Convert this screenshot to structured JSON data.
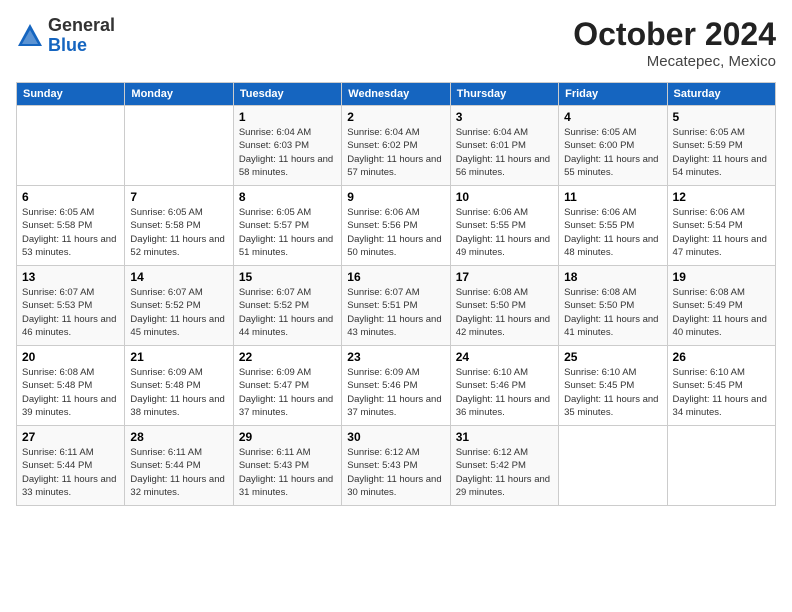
{
  "header": {
    "logo_line1": "General",
    "logo_line2": "Blue",
    "month_year": "October 2024",
    "location": "Mecatepec, Mexico"
  },
  "weekdays": [
    "Sunday",
    "Monday",
    "Tuesday",
    "Wednesday",
    "Thursday",
    "Friday",
    "Saturday"
  ],
  "weeks": [
    [
      {
        "day": "",
        "detail": ""
      },
      {
        "day": "",
        "detail": ""
      },
      {
        "day": "1",
        "detail": "Sunrise: 6:04 AM\nSunset: 6:03 PM\nDaylight: 11 hours and 58 minutes."
      },
      {
        "day": "2",
        "detail": "Sunrise: 6:04 AM\nSunset: 6:02 PM\nDaylight: 11 hours and 57 minutes."
      },
      {
        "day": "3",
        "detail": "Sunrise: 6:04 AM\nSunset: 6:01 PM\nDaylight: 11 hours and 56 minutes."
      },
      {
        "day": "4",
        "detail": "Sunrise: 6:05 AM\nSunset: 6:00 PM\nDaylight: 11 hours and 55 minutes."
      },
      {
        "day": "5",
        "detail": "Sunrise: 6:05 AM\nSunset: 5:59 PM\nDaylight: 11 hours and 54 minutes."
      }
    ],
    [
      {
        "day": "6",
        "detail": "Sunrise: 6:05 AM\nSunset: 5:58 PM\nDaylight: 11 hours and 53 minutes."
      },
      {
        "day": "7",
        "detail": "Sunrise: 6:05 AM\nSunset: 5:58 PM\nDaylight: 11 hours and 52 minutes."
      },
      {
        "day": "8",
        "detail": "Sunrise: 6:05 AM\nSunset: 5:57 PM\nDaylight: 11 hours and 51 minutes."
      },
      {
        "day": "9",
        "detail": "Sunrise: 6:06 AM\nSunset: 5:56 PM\nDaylight: 11 hours and 50 minutes."
      },
      {
        "day": "10",
        "detail": "Sunrise: 6:06 AM\nSunset: 5:55 PM\nDaylight: 11 hours and 49 minutes."
      },
      {
        "day": "11",
        "detail": "Sunrise: 6:06 AM\nSunset: 5:55 PM\nDaylight: 11 hours and 48 minutes."
      },
      {
        "day": "12",
        "detail": "Sunrise: 6:06 AM\nSunset: 5:54 PM\nDaylight: 11 hours and 47 minutes."
      }
    ],
    [
      {
        "day": "13",
        "detail": "Sunrise: 6:07 AM\nSunset: 5:53 PM\nDaylight: 11 hours and 46 minutes."
      },
      {
        "day": "14",
        "detail": "Sunrise: 6:07 AM\nSunset: 5:52 PM\nDaylight: 11 hours and 45 minutes."
      },
      {
        "day": "15",
        "detail": "Sunrise: 6:07 AM\nSunset: 5:52 PM\nDaylight: 11 hours and 44 minutes."
      },
      {
        "day": "16",
        "detail": "Sunrise: 6:07 AM\nSunset: 5:51 PM\nDaylight: 11 hours and 43 minutes."
      },
      {
        "day": "17",
        "detail": "Sunrise: 6:08 AM\nSunset: 5:50 PM\nDaylight: 11 hours and 42 minutes."
      },
      {
        "day": "18",
        "detail": "Sunrise: 6:08 AM\nSunset: 5:50 PM\nDaylight: 11 hours and 41 minutes."
      },
      {
        "day": "19",
        "detail": "Sunrise: 6:08 AM\nSunset: 5:49 PM\nDaylight: 11 hours and 40 minutes."
      }
    ],
    [
      {
        "day": "20",
        "detail": "Sunrise: 6:08 AM\nSunset: 5:48 PM\nDaylight: 11 hours and 39 minutes."
      },
      {
        "day": "21",
        "detail": "Sunrise: 6:09 AM\nSunset: 5:48 PM\nDaylight: 11 hours and 38 minutes."
      },
      {
        "day": "22",
        "detail": "Sunrise: 6:09 AM\nSunset: 5:47 PM\nDaylight: 11 hours and 37 minutes."
      },
      {
        "day": "23",
        "detail": "Sunrise: 6:09 AM\nSunset: 5:46 PM\nDaylight: 11 hours and 37 minutes."
      },
      {
        "day": "24",
        "detail": "Sunrise: 6:10 AM\nSunset: 5:46 PM\nDaylight: 11 hours and 36 minutes."
      },
      {
        "day": "25",
        "detail": "Sunrise: 6:10 AM\nSunset: 5:45 PM\nDaylight: 11 hours and 35 minutes."
      },
      {
        "day": "26",
        "detail": "Sunrise: 6:10 AM\nSunset: 5:45 PM\nDaylight: 11 hours and 34 minutes."
      }
    ],
    [
      {
        "day": "27",
        "detail": "Sunrise: 6:11 AM\nSunset: 5:44 PM\nDaylight: 11 hours and 33 minutes."
      },
      {
        "day": "28",
        "detail": "Sunrise: 6:11 AM\nSunset: 5:44 PM\nDaylight: 11 hours and 32 minutes."
      },
      {
        "day": "29",
        "detail": "Sunrise: 6:11 AM\nSunset: 5:43 PM\nDaylight: 11 hours and 31 minutes."
      },
      {
        "day": "30",
        "detail": "Sunrise: 6:12 AM\nSunset: 5:43 PM\nDaylight: 11 hours and 30 minutes."
      },
      {
        "day": "31",
        "detail": "Sunrise: 6:12 AM\nSunset: 5:42 PM\nDaylight: 11 hours and 29 minutes."
      },
      {
        "day": "",
        "detail": ""
      },
      {
        "day": "",
        "detail": ""
      }
    ]
  ]
}
